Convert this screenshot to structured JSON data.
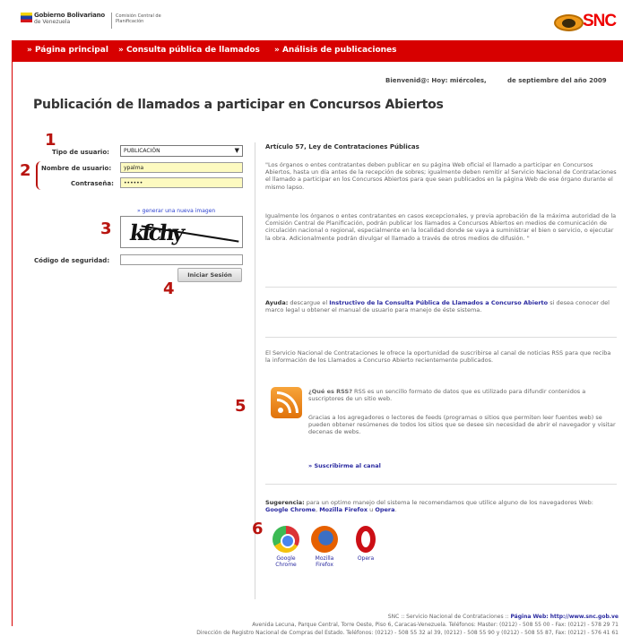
{
  "header": {
    "gob_line1": "Gobierno Bolivariano",
    "gob_line2": "de Venezuela",
    "comision": "Comisión Central de Planificación",
    "logo_text": "SNC"
  },
  "nav": {
    "items": [
      "» Página principal",
      "» Consulta pública de llamados",
      "» Análisis de publicaciones"
    ]
  },
  "welcome": {
    "left": "Bienvenid@: Hoy: miércoles,",
    "right": "de septiembre del año 2009"
  },
  "page_title": "Publicación de llamados a participar en Concursos Abiertos",
  "form": {
    "tipo_label": "Tipo de usuario:",
    "tipo_value": "PUBLICACIÓN",
    "usuario_label": "Nombre de usuario:",
    "usuario_value": "ypalma",
    "pass_label": "Contraseña:",
    "pass_value": "••••••",
    "new_image": "» generar una nueva imagen",
    "captcha_text": "kfchy",
    "codigo_label": "Código de seguridad:",
    "login_button": "Iniciar Sesión"
  },
  "annotations": [
    "1",
    "2",
    "3",
    "4",
    "5",
    "6"
  ],
  "article": {
    "title": "Artículo 57, Ley de Contrataciones Públicas",
    "p1": "\"Los órganos o entes contratantes deben publicar en su página Web oficial el llamado a participar en Concursos Abiertos, hasta un día antes de la recepción de sobres; igualmente deben remitir al Servicio Nacional de Contrataciones el llamado a participar en los Concursos Abiertos para que sean publicados en la página Web de ese órgano durante el mismo lapso.",
    "p2": "Igualmente los órganos o entes contratantes en casos excepcionales, y previa aprobación de la máxima autoridad de la Comisión Central de Planificación, podrán publicar los llamados a Concursos Abiertos en medios de comunicación de circulación nacional o regional, especialmente en la localidad donde se vaya a suministrar el bien o servicio, o ejecutar la obra. Adicionalmente podrán divulgar el llamado a través de otros medios de difusión. \""
  },
  "help": {
    "label": "Ayuda:",
    "pre": " descargue el ",
    "link": "Instructivo de la Consulta Pública de Llamados a Concurso Abierto",
    "post": " si desea conocer del marco legal u obtener el manual de usuario para manejo de éste sistema."
  },
  "rss": {
    "intro": "El Servicio Nacional de Contrataciones le ofrece la oportunidad de suscribirse al canal de noticias RSS para que reciba la información de los Llamados a Concurso Abierto recientemente publicados.",
    "q": "¿Qué es RSS?",
    "a": " RSS es un sencillo formato de datos que es utilizado para difundir contenidos a suscriptores de un sitio web.",
    "p2": "Gracias a los agregadores o lectores de feeds (programas o sitios que permiten leer fuentes web) se pueden obtener resúmenes de todos los sitios que se desee sin necesidad de abrir el navegador y visitar decenas de webs.",
    "subscribe": "» Suscribirme al canal"
  },
  "suggest": {
    "label": "Sugerencia:",
    "text": " para un optimo manejo del sistema le recomendamos que utilice alguno de los navegadores Web: ",
    "b1": "Google Chrome",
    "sep": ", ",
    "b2": "Mozilla Firefox",
    "or": " u ",
    "b3": "Opera",
    "end": "."
  },
  "browsers": [
    {
      "name": "Google\nChrome"
    },
    {
      "name": "Mozilla\nFirefox"
    },
    {
      "name": "Opera"
    }
  ],
  "footer": {
    "line1_pre": "SNC :: Servicio Nacional de Contrataciones :: ",
    "line1_link": "Página Web: http://www.snc.gob.ve",
    "line2": "Avenida Lecuna, Parque Central, Torre Oeste, Piso 6, Caracas-Venezuela. Teléfonos: Master: (0212) - 508 55 00 - Fax: (0212) - 578 29 71",
    "line3": "Dirección de Registro Nacional de Compras del Estado. Teléfonos: (0212) - 508 55 32 al 39, (0212) - 508 55 90 y (0212) - 508 55 87, Fax: (0212) - 576 41 61"
  },
  "colors": {
    "nav_red": "#d70000",
    "annotation_red": "#b8140f",
    "link_blue": "#2a2aa0",
    "input_yellow": "#fdfac0"
  }
}
